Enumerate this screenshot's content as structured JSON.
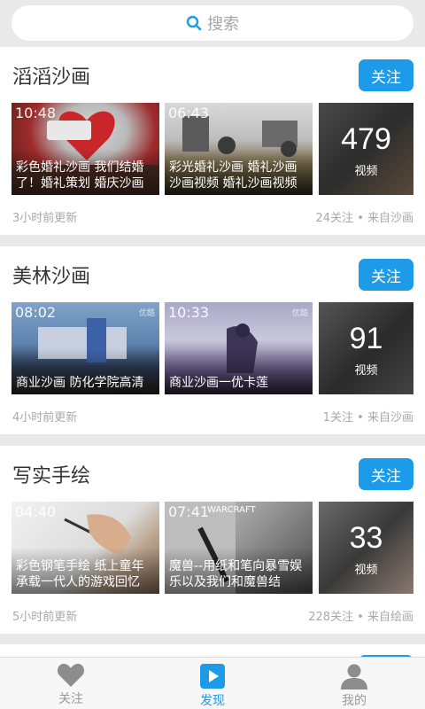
{
  "search": {
    "placeholder": "搜索",
    "icon": "search-icon"
  },
  "cards": [
    {
      "title": "滔滔沙画",
      "follow_label": "关注",
      "videos": [
        {
          "duration": "10:48",
          "caption": "彩色婚礼沙画 我们结婚了！婚礼策划 婚庆沙画"
        },
        {
          "duration": "06:43",
          "caption": "彩光婚礼沙画 婚礼沙画 沙画视频 婚礼沙画视频"
        }
      ],
      "video_count": "479",
      "video_count_label": "视频",
      "updated": "3小时前更新",
      "meta": "24关注 • 来自沙画"
    },
    {
      "title": "美林沙画",
      "follow_label": "关注",
      "videos": [
        {
          "duration": "08:02",
          "caption": "商业沙画 防化学院高清",
          "logo": "优酷"
        },
        {
          "duration": "10:33",
          "caption": "商业沙画一优卡莲",
          "logo": "优酷"
        }
      ],
      "video_count": "91",
      "video_count_label": "视频",
      "updated": "4小时前更新",
      "meta": "1关注 • 来自沙画"
    },
    {
      "title": "写实手绘",
      "follow_label": "关注",
      "videos": [
        {
          "duration": "04:40",
          "caption": "彩色钢笔手绘 纸上童年 承载一代人的游戏回忆"
        },
        {
          "duration": "07:41",
          "caption": "魔兽--用纸和笔向暴雪娱乐以及我们和魔兽结",
          "logo": "WARCRAFT"
        }
      ],
      "video_count": "33",
      "video_count_label": "视频",
      "updated": "5小时前更新",
      "meta": "228关注 • 来自绘画"
    }
  ],
  "tabs": [
    {
      "label": "关注",
      "icon": "heart-icon"
    },
    {
      "label": "发现",
      "icon": "play-icon"
    },
    {
      "label": "我的",
      "icon": "person-icon"
    }
  ],
  "colors": {
    "accent": "#1e9be8",
    "background": "#e9e9e9"
  }
}
